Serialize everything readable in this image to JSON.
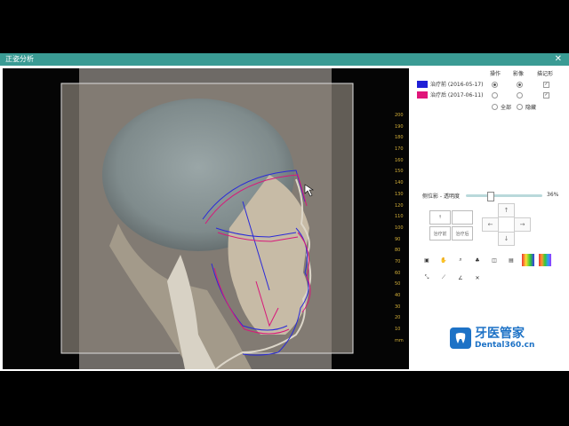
{
  "window": {
    "title": "正姿分析",
    "close_symbol": "✕"
  },
  "legend": {
    "headers": {
      "operate": "操作",
      "image": "影像",
      "trace": "描记形"
    },
    "records": [
      {
        "label": "治疗前 (2016-05-17)",
        "color": "#1f1fd6"
      },
      {
        "label": "治疗后 (2017-06-11)",
        "color": "#e0167a"
      }
    ],
    "options": {
      "all": "全部",
      "hide": "隐藏"
    }
  },
  "opacity": {
    "label": "侧位影 - 透明度",
    "value": "36%"
  },
  "overlay_buttons": {
    "before": "治疗前",
    "after": "治疗后"
  },
  "ruler": {
    "ticks": [
      "200",
      "190",
      "180",
      "170",
      "160",
      "150",
      "140",
      "130",
      "120",
      "110",
      "100",
      "90",
      "80",
      "70",
      "60",
      "50",
      "40",
      "30",
      "20",
      "10",
      "mm"
    ]
  },
  "brand": {
    "name_cn": "牙医管家",
    "name_en": "Dental360.cn"
  },
  "tools": [
    "print-icon",
    "hand-icon",
    "zoom-icon",
    "color-icon",
    "contrast-icon",
    "invert-icon",
    "palette-icon",
    "measure-icon",
    "line-icon",
    "angle-icon",
    "delete-icon"
  ],
  "colors": {
    "titlebar": "#3a9b94",
    "pre_treatment": "#1f1fd6",
    "post_treatment": "#e0167a",
    "brand": "#1d72c6"
  }
}
